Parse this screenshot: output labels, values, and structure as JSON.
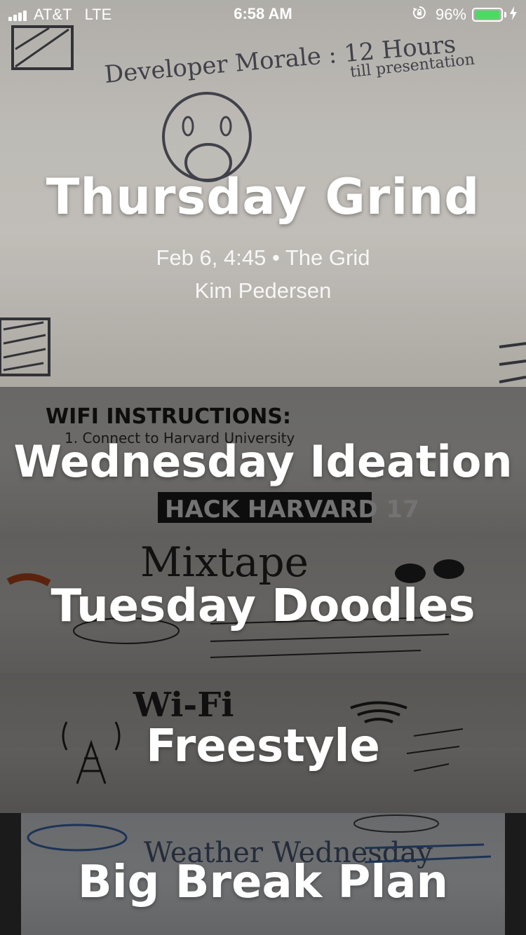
{
  "status_bar": {
    "carrier": "AT&T",
    "network": "LTE",
    "time": "6:58 AM",
    "battery_percent": "96%",
    "battery_level": 0.96,
    "battery_color": "#4cd964"
  },
  "sessions": [
    {
      "title": "Thursday Grind",
      "meta": "Feb 6, 4:45 • The Grid",
      "host": "Kim Pedersen"
    },
    {
      "title": "Wednesday Ideation"
    },
    {
      "title": "Tuesday Doodles"
    },
    {
      "title": "Freestyle"
    },
    {
      "title": "Big Break Plan"
    }
  ],
  "photo_text": {
    "whiteboard_line_1": "Developer Morale : 12 Hours",
    "whiteboard_line_2": "till presentation",
    "wifi_heading": "WIFI INSTRUCTIONS:",
    "wifi_step": "1. Connect to Harvard University",
    "hack_logo": "HACK HARVARD 17",
    "mixtape": "Mixtape",
    "wifi_doodle": "Wi-Fi",
    "weather": "Weather Wednesday"
  },
  "icons": {
    "signal": "signal-bars-icon",
    "rotation_lock": "rotation-lock-icon",
    "battery": "battery-icon",
    "charging": "charging-bolt-icon"
  }
}
